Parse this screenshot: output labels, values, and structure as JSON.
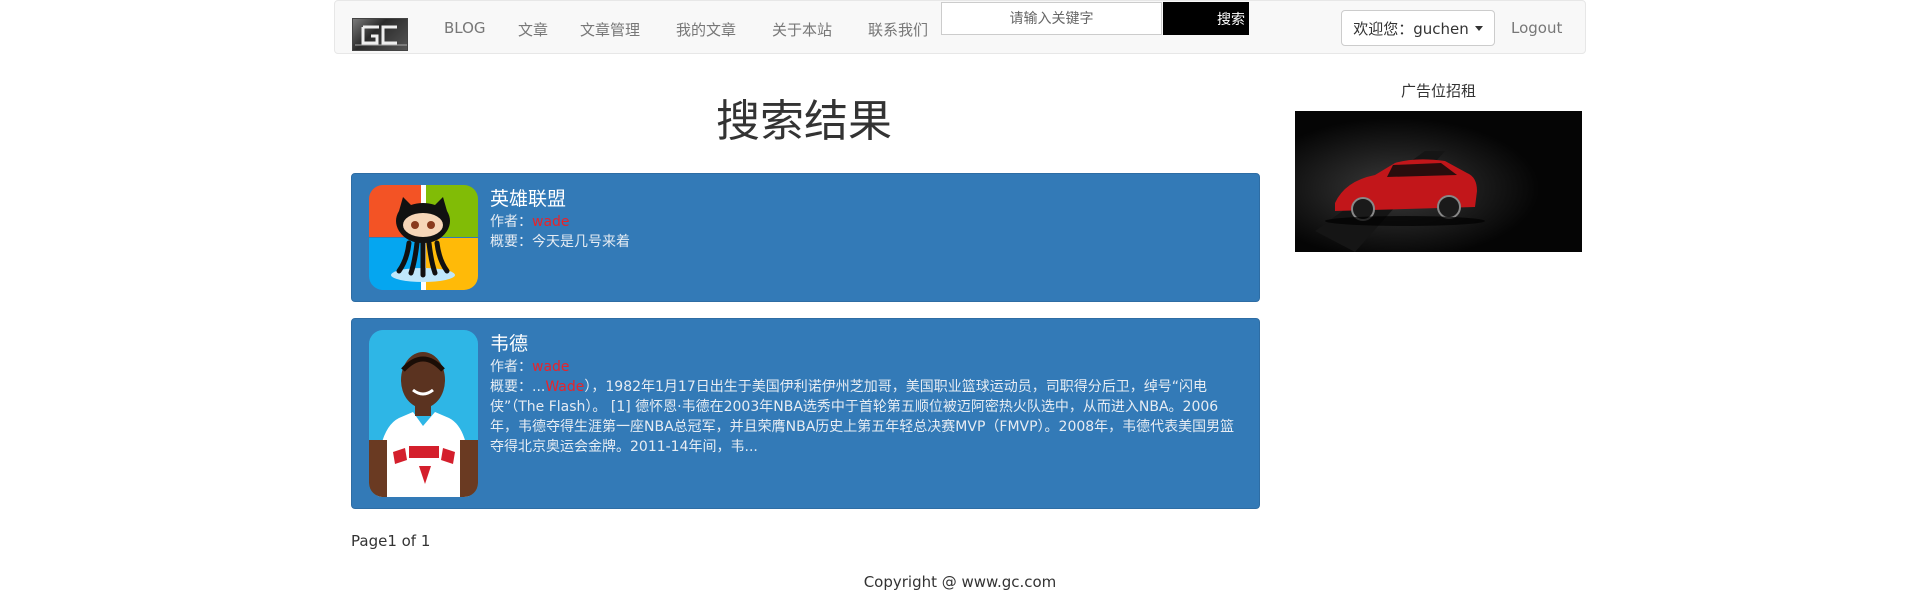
{
  "nav": {
    "items": [
      {
        "label": "BLOG"
      },
      {
        "label": "文章"
      },
      {
        "label": "文章管理"
      },
      {
        "label": "我的文章"
      },
      {
        "label": "关于本站"
      },
      {
        "label": "联系我们"
      }
    ],
    "search_placeholder": "请输入关键字",
    "search_button": "搜索",
    "user_greeting": "欢迎您：guchen",
    "logout": "Logout"
  },
  "page_title": "搜索结果",
  "results": [
    {
      "title": "英雄联盟",
      "author_label": "作者：",
      "author": "wade",
      "summary_label": "概要：",
      "summary": "今天是几号来着"
    },
    {
      "title": "韦德",
      "author_label": "作者：",
      "author": "wade",
      "summary_label": "概要：",
      "summary_prefix": "...",
      "summary_highlight": "Wade",
      "summary_rest": "），1982年1月17日出生于美国伊利诺伊州芝加哥，美国职业篮球运动员，司职得分后卫，绰号“闪电侠”（The Flash）。 [1] 德怀恩·韦德在2003年NBA选秀中于首轮第五顺位被迈阿密热火队选中，从而进入NBA。2006年，韦德夺得生涯第一座NBA总冠军，并且荣膺NBA历史上第五年轻总决赛MVP（FMVP）。2008年，韦德代表美国男篮夺得北京奥运会金牌。2011-14年间，韦..."
    }
  ],
  "pagination": "Page1 of 1",
  "sidebar": {
    "ad_title": "广告位招租"
  },
  "footer": "Copyright @ www.gc.com",
  "colors": {
    "card_bg": "#337ab7",
    "highlight": "#e8232a",
    "navbar_bg": "#f8f8f8"
  }
}
